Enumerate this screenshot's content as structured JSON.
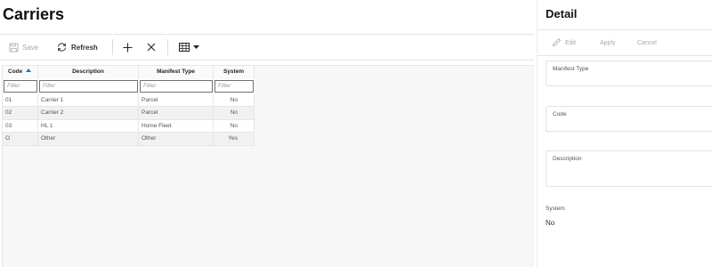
{
  "page": {
    "title": "Carriers"
  },
  "toolbar": {
    "save_label": "Save",
    "refresh_label": "Refresh"
  },
  "grid": {
    "columns": [
      {
        "key": "code",
        "label": "Code",
        "sorted": "ascending"
      },
      {
        "key": "description",
        "label": "Description"
      },
      {
        "key": "manifest_type",
        "label": "Manifest Type"
      },
      {
        "key": "system",
        "label": "System"
      }
    ],
    "filter_placeholder": "Filter",
    "rows": [
      {
        "code": "01",
        "description": "Carrier 1",
        "manifest_type": "Parcel",
        "system": "No"
      },
      {
        "code": "02",
        "description": "Carrier 2",
        "manifest_type": "Parcel",
        "system": "No"
      },
      {
        "code": "03",
        "description": "HL 1",
        "manifest_type": "Home Fleet",
        "system": "No"
      },
      {
        "code": "O",
        "description": "Other",
        "manifest_type": "Other",
        "system": "Yes"
      }
    ]
  },
  "detail": {
    "title": "Detail",
    "edit_label": "Edit",
    "apply_label": "Apply",
    "cancel_label": "Cancel",
    "fields": {
      "manifest_type_label": "Manifest Type",
      "manifest_type_value": "",
      "code_label": "Code",
      "code_value": "",
      "description_label": "Description",
      "description_value": ""
    },
    "system_label": "System",
    "system_value": "No"
  },
  "colors": {
    "accent": "#2a6bd1",
    "disabled_text": "#a8a8a8",
    "grid_background": "#f7f7f7"
  },
  "icons": [
    "save-icon",
    "refresh-icon",
    "add-icon",
    "delete-icon",
    "columns-icon",
    "caret-down-icon",
    "sort-ascending-icon",
    "edit-pencil-icon"
  ]
}
